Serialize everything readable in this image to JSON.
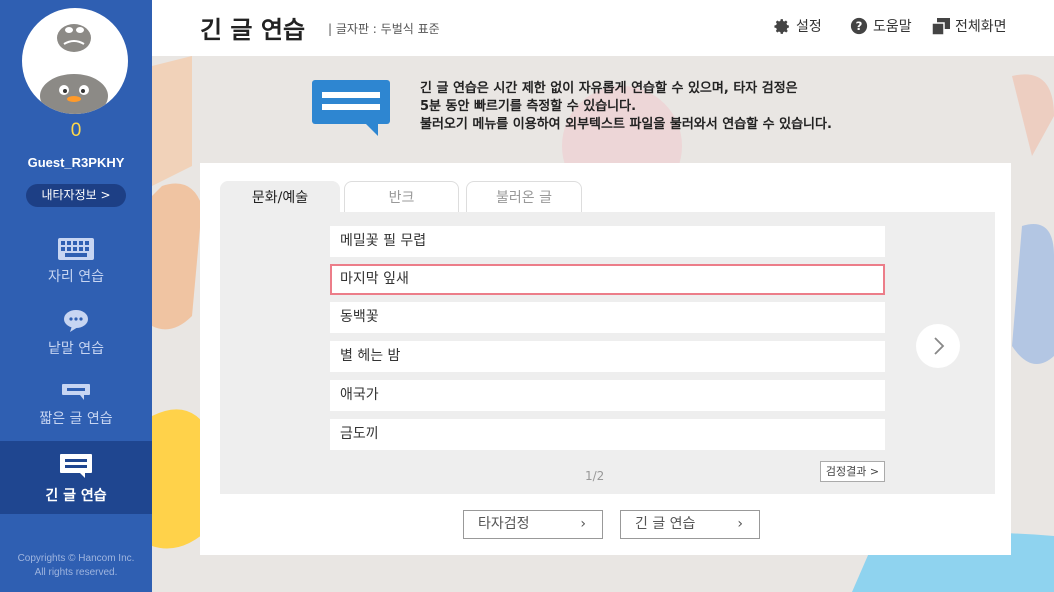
{
  "sidebar": {
    "score": "0",
    "username": "Guest_R3PKHY",
    "myinfo_label": "내타자정보 >",
    "items": [
      {
        "label": "자리 연습",
        "icon": "keyboard-icon"
      },
      {
        "label": "낱말 연습",
        "icon": "speech-bubble-icon"
      },
      {
        "label": "짧은 글 연습",
        "icon": "short-text-icon"
      },
      {
        "label": "긴 글 연습",
        "icon": "long-text-icon",
        "active": true
      }
    ],
    "copyright_line1": "Copyrights © Hancom Inc.",
    "copyright_line2": "All rights reserved."
  },
  "header": {
    "title": "긴 글 연습",
    "subtitle": "| 글자판 : 두벌식 표준",
    "settings_label": "설정",
    "help_label": "도움말",
    "fullscreen_label": "전체화면"
  },
  "info": {
    "line1": "긴 글 연습은 시간 제한 없이 자유롭게 연습할 수 있으며, 타자 검정은",
    "line2": "5분 동안 빠르기를 측정할 수 있습니다.",
    "line3": "불러오기 메뉴를 이용하여 외부텍스트 파일을 불러와서 연습할 수 있습니다."
  },
  "tabs": [
    {
      "label": "문화/예술",
      "active": true
    },
    {
      "label": "반크"
    },
    {
      "label": "불러온 글"
    }
  ],
  "list": [
    {
      "title": "메밀꽃 필 무렵"
    },
    {
      "title": "마지막 잎새",
      "selected": true
    },
    {
      "title": "동백꽃"
    },
    {
      "title": "별 헤는 밤"
    },
    {
      "title": "애국가"
    },
    {
      "title": "금도끼"
    }
  ],
  "page_indicator": "1/2",
  "result_button": "검정결과 >",
  "bottom_buttons": {
    "test_label": "타자검정",
    "practice_label": "긴 글 연습"
  },
  "colors": {
    "sidebar": "#2f5fb2",
    "sidebar_active": "#1f4690",
    "score": "#ffd84a",
    "selected_border": "#ec7d89",
    "info_icon": "#2e86d1"
  }
}
